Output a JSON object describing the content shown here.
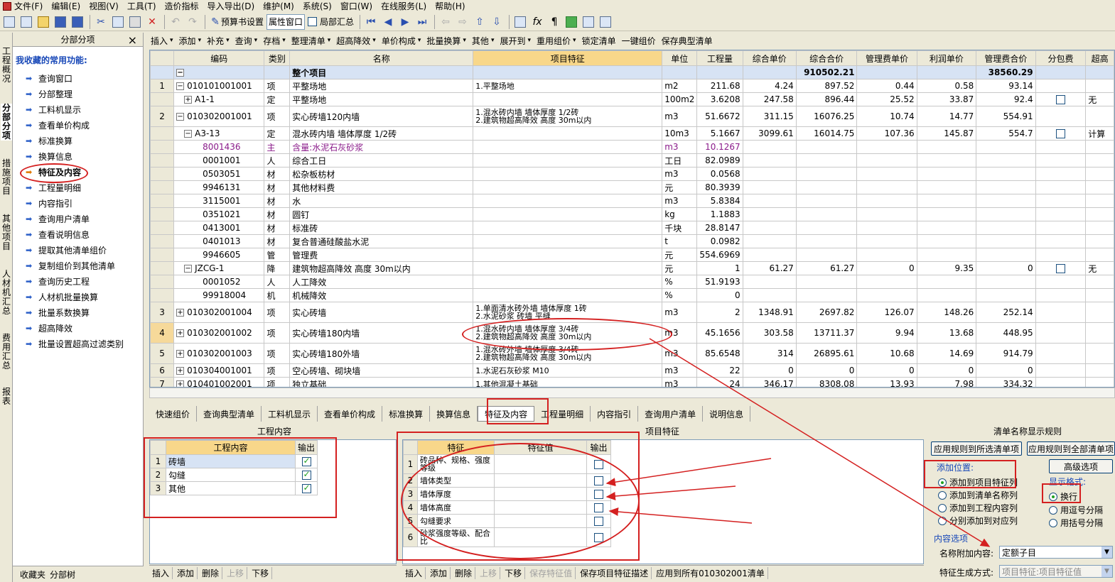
{
  "menu": [
    "文件(F)",
    "编辑(E)",
    "视图(V)",
    "工具(T)",
    "造价指标",
    "导入导出(D)",
    "维护(M)",
    "系统(S)",
    "窗口(W)",
    "在线服务(L)",
    "帮助(H)"
  ],
  "toolbar1": {
    "budget_settings": "预算书设置",
    "property_window": "属性窗口",
    "partial_summary": "局部汇总"
  },
  "vtabs": [
    "工程概况",
    "分部分项",
    "措施项目",
    "其他项目",
    "人材机汇总",
    "费用汇总",
    "报表"
  ],
  "left_panel": {
    "title": "分部分项",
    "close_glyph": "×",
    "favorites_title": "我收藏的常用功能:",
    "items": [
      "查询窗口",
      "分部整理",
      "工料机显示",
      "查看单价构成",
      "标准换算",
      "换算信息",
      "特征及内容",
      "工程量明细",
      "内容指引",
      "查询用户清单",
      "查看说明信息",
      "提取其他清单组价",
      "复制组价到其他清单",
      "查询历史工程",
      "人材机批量换算",
      "批量系数换算",
      "超高降效",
      "批量设置超高过滤类别"
    ],
    "bottom_tabs": [
      "收藏夹",
      "分部树"
    ]
  },
  "toolbar2": [
    "插入",
    "添加",
    "补充",
    "查询",
    "存档",
    "整理清单",
    "超高降效",
    "单价构成",
    "批量换算",
    "其他",
    "展开到",
    "重用组价",
    "锁定清单",
    "一键组价",
    "保存典型清单"
  ],
  "grid": {
    "headers": [
      "编码",
      "类别",
      "名称",
      "项目特征",
      "单位",
      "工程量",
      "综合单价",
      "综合合价",
      "管理费单价",
      "利润单价",
      "管理费合价",
      "分包费",
      "超高"
    ],
    "top_row": {
      "name": "整个项目",
      "total": "910502.21",
      "mgmt_total": "38560.29"
    },
    "rows": [
      {
        "no": "1",
        "pm": "−",
        "code": "010101001001",
        "cat": "项",
        "name": "平整场地",
        "feat": "1.平整场地",
        "unit": "m2",
        "qty": "211.68",
        "up": "4.24",
        "tp": "897.52",
        "mu": "0.44",
        "pu": "0.58",
        "mt": "93.14",
        "sub": "",
        "extra": ""
      },
      {
        "no": "",
        "pm": "+",
        "code": "A1-1",
        "cat": "定",
        "name": "平整场地",
        "feat": "",
        "unit": "100m2",
        "qty": "3.6208",
        "up": "247.58",
        "tp": "896.44",
        "mu": "25.52",
        "pu": "33.87",
        "mt": "92.4",
        "sub": "box",
        "extra": "无"
      },
      {
        "no": "2",
        "pm": "−",
        "code": "010302001001",
        "cat": "项",
        "name": "实心砖墙120内墙",
        "feat": "1.混水砖内墙 墙体厚度 1/2砖\n2.建筑物超高降效 高度 30m以内",
        "unit": "m3",
        "qty": "51.6672",
        "up": "311.15",
        "tp": "16076.25",
        "mu": "10.74",
        "pu": "14.77",
        "mt": "554.91",
        "sub": "",
        "extra": ""
      },
      {
        "no": "",
        "pm": "−",
        "code": "A3-13",
        "cat": "定",
        "name": "混水砖内墙 墙体厚度 1/2砖",
        "feat": "",
        "unit": "10m3",
        "qty": "5.1667",
        "up": "3099.61",
        "tp": "16014.75",
        "mu": "107.36",
        "pu": "145.87",
        "mt": "554.7",
        "sub": "box",
        "extra": "计算"
      },
      {
        "no": "",
        "pm": "",
        "code": "8001436",
        "cat": "主",
        "name": "含量:水泥石灰砂浆",
        "feat": "",
        "unit": "m3",
        "qty": "10.1267",
        "up": "",
        "tp": "",
        "mu": "",
        "pu": "",
        "mt": "",
        "sub": "",
        "extra": ""
      },
      {
        "no": "",
        "pm": "",
        "code": "0001001",
        "cat": "人",
        "name": "综合工日",
        "feat": "",
        "unit": "工日",
        "qty": "82.0989",
        "up": "",
        "tp": "",
        "mu": "",
        "pu": "",
        "mt": "",
        "sub": "",
        "extra": ""
      },
      {
        "no": "",
        "pm": "",
        "code": "0503051",
        "cat": "材",
        "name": "松杂板枋材",
        "feat": "",
        "unit": "m3",
        "qty": "0.0568",
        "up": "",
        "tp": "",
        "mu": "",
        "pu": "",
        "mt": "",
        "sub": "",
        "extra": ""
      },
      {
        "no": "",
        "pm": "",
        "code": "9946131",
        "cat": "材",
        "name": "其他材料费",
        "feat": "",
        "unit": "元",
        "qty": "80.3939",
        "up": "",
        "tp": "",
        "mu": "",
        "pu": "",
        "mt": "",
        "sub": "",
        "extra": ""
      },
      {
        "no": "",
        "pm": "",
        "code": "3115001",
        "cat": "材",
        "name": "水",
        "feat": "",
        "unit": "m3",
        "qty": "5.8384",
        "up": "",
        "tp": "",
        "mu": "",
        "pu": "",
        "mt": "",
        "sub": "",
        "extra": ""
      },
      {
        "no": "",
        "pm": "",
        "code": "0351021",
        "cat": "材",
        "name": "圆钉",
        "feat": "",
        "unit": "kg",
        "qty": "1.1883",
        "up": "",
        "tp": "",
        "mu": "",
        "pu": "",
        "mt": "",
        "sub": "",
        "extra": ""
      },
      {
        "no": "",
        "pm": "",
        "code": "0413001",
        "cat": "材",
        "name": "标准砖",
        "feat": "",
        "unit": "千块",
        "qty": "28.8147",
        "up": "",
        "tp": "",
        "mu": "",
        "pu": "",
        "mt": "",
        "sub": "",
        "extra": ""
      },
      {
        "no": "",
        "pm": "",
        "code": "0401013",
        "cat": "材",
        "name": "复合普通硅酸盐水泥",
        "feat": "",
        "unit": "t",
        "qty": "0.0982",
        "up": "",
        "tp": "",
        "mu": "",
        "pu": "",
        "mt": "",
        "sub": "",
        "extra": ""
      },
      {
        "no": "",
        "pm": "",
        "code": "9946605",
        "cat": "管",
        "name": "管理费",
        "feat": "",
        "unit": "元",
        "qty": "554.6969",
        "up": "",
        "tp": "",
        "mu": "",
        "pu": "",
        "mt": "",
        "sub": "",
        "extra": ""
      },
      {
        "no": "",
        "pm": "−",
        "code": "JZCG-1",
        "cat": "降",
        "name": "建筑物超高降效 高度 30m以内",
        "feat": "",
        "unit": "元",
        "qty": "1",
        "up": "61.27",
        "tp": "61.27",
        "mu": "0",
        "pu": "9.35",
        "mt": "0",
        "sub": "box",
        "extra": "无"
      },
      {
        "no": "",
        "pm": "",
        "code": "0001052",
        "cat": "人",
        "name": "人工降效",
        "feat": "",
        "unit": "%",
        "qty": "51.9193",
        "up": "",
        "tp": "",
        "mu": "",
        "pu": "",
        "mt": "",
        "sub": "",
        "extra": ""
      },
      {
        "no": "",
        "pm": "",
        "code": "99918004",
        "cat": "机",
        "name": "机械降效",
        "feat": "",
        "unit": "%",
        "qty": "0",
        "up": "",
        "tp": "",
        "mu": "",
        "pu": "",
        "mt": "",
        "sub": "",
        "extra": ""
      },
      {
        "no": "3",
        "pm": "+",
        "code": "010302001004",
        "cat": "项",
        "name": "实心砖墙",
        "feat": "1.单面清水砖外墙 墙体厚度 1砖\n2.水泥砂浆 砖墙 平缝",
        "unit": "m3",
        "qty": "2",
        "up": "1348.91",
        "tp": "2697.82",
        "mu": "126.07",
        "pu": "148.26",
        "mt": "252.14",
        "sub": "",
        "extra": ""
      },
      {
        "no": "4",
        "pm": "+",
        "code": "010302001002",
        "cat": "项",
        "name": "实心砖墙180内墙",
        "feat": "1.混水砖内墙 墙体厚度 3/4砖\n2.建筑物超高降效 高度 30m以内",
        "unit": "m3",
        "qty": "45.1656",
        "up": "303.58",
        "tp": "13711.37",
        "mu": "9.94",
        "pu": "13.68",
        "mt": "448.95",
        "sub": "",
        "extra": ""
      },
      {
        "no": "5",
        "pm": "+",
        "code": "010302001003",
        "cat": "项",
        "name": "实心砖墙180外墙",
        "feat": "1.混水砖外墙 墙体厚度 3/4砖\n2.建筑物超高降效 高度 30m以内",
        "unit": "m3",
        "qty": "85.6548",
        "up": "314",
        "tp": "26895.61",
        "mu": "10.68",
        "pu": "14.69",
        "mt": "914.79",
        "sub": "",
        "extra": ""
      },
      {
        "no": "6",
        "pm": "+",
        "code": "010304001001",
        "cat": "项",
        "name": "空心砖墙、砌块墙",
        "feat": "1.水泥石灰砂浆 M10",
        "unit": "m3",
        "qty": "22",
        "up": "0",
        "tp": "0",
        "mu": "0",
        "pu": "0",
        "mt": "0",
        "sub": "",
        "extra": ""
      },
      {
        "no": "7",
        "pm": "+",
        "code": "010401002001",
        "cat": "项",
        "name": "独立基础",
        "feat": "1.其他混凝土基础",
        "unit": "m3",
        "qty": "24",
        "up": "346.17",
        "tp": "8308.08",
        "mu": "13.93",
        "pu": "7.98",
        "mt": "334.32",
        "sub": "",
        "extra": ""
      }
    ]
  },
  "bottom_tabs": [
    "快速组价",
    "查询典型清单",
    "工料机显示",
    "查看单价构成",
    "标准换算",
    "换算信息",
    "特征及内容",
    "工程量明细",
    "内容指引",
    "查询用户清单",
    "说明信息"
  ],
  "work_content": {
    "title": "工程内容",
    "headers": [
      "工程内容",
      "输出"
    ],
    "rows": [
      {
        "no": "1",
        "name": "砖墙"
      },
      {
        "no": "2",
        "name": "勾缝"
      },
      {
        "no": "3",
        "name": "其他"
      }
    ],
    "bar": [
      "插入",
      "添加",
      "删除",
      "上移",
      "下移"
    ]
  },
  "features": {
    "title": "项目特征",
    "headers": [
      "特征",
      "特征值",
      "输出"
    ],
    "rows": [
      {
        "no": "1",
        "name": "砖品种、规格、强度等级"
      },
      {
        "no": "2",
        "name": "墙体类型"
      },
      {
        "no": "3",
        "name": "墙体厚度"
      },
      {
        "no": "4",
        "name": "墙体高度"
      },
      {
        "no": "5",
        "name": "勾缝要求"
      },
      {
        "no": "6",
        "name": "砂浆强度等级、配合比"
      }
    ],
    "bar": [
      "插入",
      "添加",
      "删除",
      "上移",
      "下移",
      "保存特征值",
      "保存项目特征描述",
      "应用到所有010302001清单"
    ]
  },
  "rules": {
    "title": "清单名称显示规则",
    "apply_selected": "应用规则到所选清单项",
    "apply_all": "应用规则到全部清单项",
    "position_label": "添加位置:",
    "advanced": "高级选项",
    "positions": [
      "添加到项目特征列",
      "添加到清单名称列",
      "添加到工程内容列",
      "分别添加到对应列"
    ],
    "format_label": "显示格式:",
    "formats": [
      "换行",
      "用逗号分隔",
      "用括号分隔"
    ],
    "content_label": "内容选项",
    "append_label": "名称附加内容:",
    "append_value": "定额子目",
    "gen_label": "特征生成方式:",
    "gen_value": "项目特征:项目特征值"
  }
}
